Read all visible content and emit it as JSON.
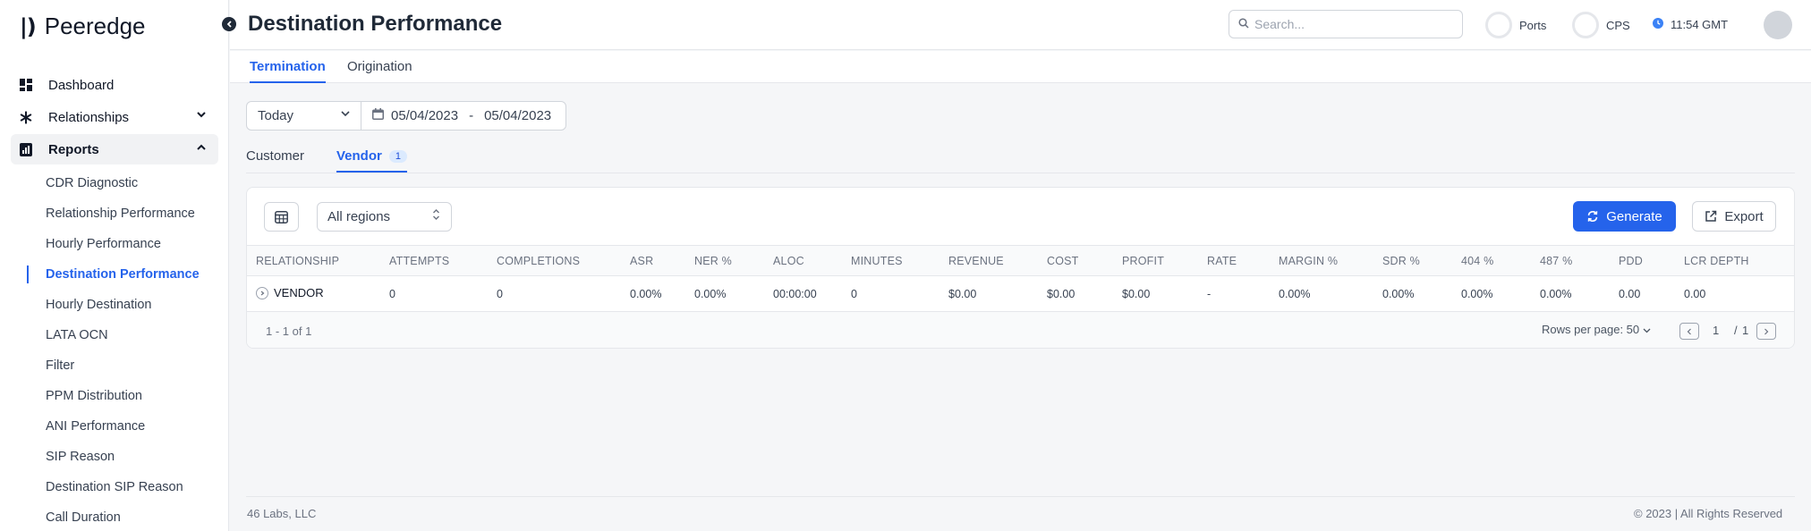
{
  "app": {
    "logo_mark": "|)",
    "name": "Peeredge"
  },
  "sidebar": {
    "items": [
      {
        "label": "Dashboard",
        "icon": "dashboard-icon"
      },
      {
        "label": "Relationships",
        "icon": "asterisk-icon",
        "expandable": true,
        "expanded": false
      },
      {
        "label": "Reports",
        "icon": "reports-icon",
        "expandable": true,
        "expanded": true
      }
    ],
    "reports_subitems": [
      "CDR Diagnostic",
      "Relationship Performance",
      "Hourly Performance",
      "Destination Performance",
      "Hourly Destination",
      "LATA OCN",
      "Filter",
      "PPM Distribution",
      "ANI Performance",
      "SIP Reason",
      "Destination SIP Reason",
      "Call Duration"
    ],
    "current_subitem": "Destination Performance"
  },
  "header": {
    "title": "Destination Performance",
    "search_placeholder": "Search...",
    "ports_label": "Ports",
    "cps_label": "CPS",
    "time": "11:54 GMT"
  },
  "tabs": [
    {
      "label": "Termination",
      "active": true
    },
    {
      "label": "Origination",
      "active": false
    }
  ],
  "filters": {
    "period": "Today",
    "date_from": "05/04/2023",
    "date_separator": "-",
    "date_to": "05/04/2023"
  },
  "subtabs": [
    {
      "label": "Customer",
      "active": false
    },
    {
      "label": "Vendor",
      "active": true,
      "badge": "1"
    }
  ],
  "toolbar": {
    "region": "All regions",
    "generate_label": "Generate",
    "export_label": "Export"
  },
  "table": {
    "columns": [
      "RELATIONSHIP",
      "ATTEMPTS",
      "COMPLETIONS",
      "ASR",
      "NER %",
      "ALOC",
      "MINUTES",
      "REVENUE",
      "COST",
      "PROFIT",
      "RATE",
      "MARGIN %",
      "SDR %",
      "404 %",
      "487 %",
      "PDD",
      "LCR DEPTH"
    ],
    "rows": [
      [
        "VENDOR",
        "0",
        "0",
        "0.00%",
        "0.00%",
        "00:00:00",
        "0",
        "$0.00",
        "$0.00",
        "$0.00",
        "-",
        "0.00%",
        "0.00%",
        "0.00%",
        "0.00%",
        "0.00",
        "0.00"
      ]
    ],
    "range_text": "1 - 1 of 1",
    "rows_per_page": "Rows per page: 50",
    "current_page": "1",
    "page_separator": "/",
    "total_pages": "1"
  },
  "footer": {
    "company": "46 Labs, LLC",
    "copyright": "© 2023 | All Rights Reserved"
  },
  "colors": {
    "accent": "#2563eb",
    "sidebar_active_bg": "#f1f2f4"
  }
}
